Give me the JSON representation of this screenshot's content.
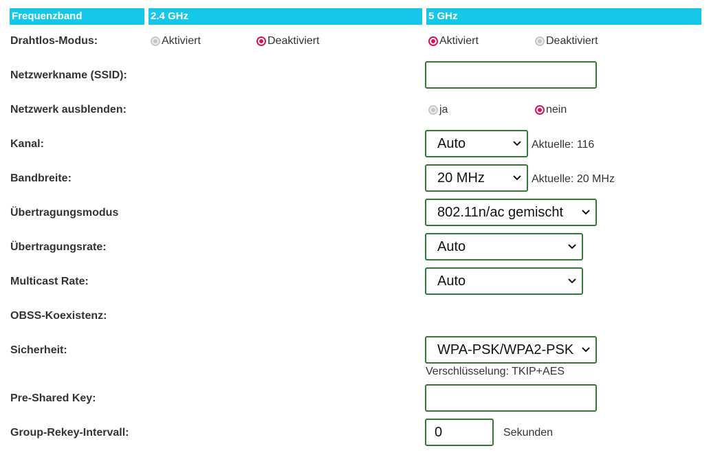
{
  "header": {
    "band_label": "Frequenzband",
    "band_24": "2.4 GHz",
    "band_5": "5 GHz"
  },
  "rows": {
    "wireless_mode": {
      "label": "Drahtlos-Modus:",
      "opt_enabled": "Aktiviert",
      "opt_disabled": "Deaktiviert",
      "value_24": "Deaktiviert",
      "value_5": "Aktiviert"
    },
    "ssid": {
      "label": "Netzwerkname (SSID):",
      "value": ""
    },
    "hide_network": {
      "label": "Netzwerk ausblenden:",
      "opt_yes": "ja",
      "opt_no": "nein",
      "value": "nein"
    },
    "channel": {
      "label": "Kanal:",
      "value": "Auto",
      "current": "Aktuelle: 116"
    },
    "bandwidth": {
      "label": "Bandbreite:",
      "value": "20 MHz",
      "current": "Aktuelle: 20 MHz"
    },
    "tx_mode": {
      "label": "Übertragungsmodus",
      "value": "802.11n/ac gemischt"
    },
    "tx_rate": {
      "label": "Übertragungsrate:",
      "value": "Auto"
    },
    "multicast_rate": {
      "label": "Multicast Rate:",
      "value": "Auto"
    },
    "obss": {
      "label": "OBSS-Koexistenz:"
    },
    "security": {
      "label": "Sicherheit:",
      "value": "WPA-PSK/WPA2-PSK",
      "encryption": "Verschlüsselung: TKIP+AES"
    },
    "psk": {
      "label": "Pre-Shared Key:",
      "value": ""
    },
    "rekey": {
      "label": "Group-Rekey-Intervall:",
      "value": "0",
      "unit": "Sekunden"
    }
  },
  "colors": {
    "header_bg": "#16c8e8",
    "radio_selected": "#d9134f",
    "field_border": "#2e7d32"
  },
  "icons": {
    "select_arrow": "chevron-down-icon"
  }
}
